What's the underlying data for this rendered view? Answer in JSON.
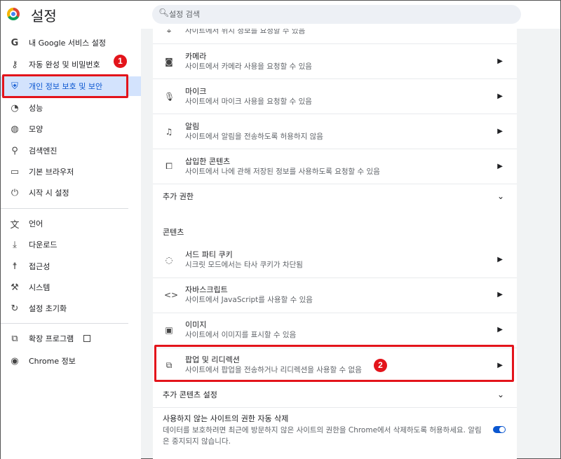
{
  "header": {
    "title": "설정",
    "search_placeholder": "설정 검색"
  },
  "sidebar": {
    "items": [
      {
        "label": "내 Google 서비스 설정",
        "icon": "google-g-icon"
      },
      {
        "label": "자동 완성 및 비밀번호",
        "icon": "key-icon"
      },
      {
        "label": "개인 정보 보호 및 보안",
        "icon": "shield-icon"
      },
      {
        "label": "성능",
        "icon": "speedometer-icon"
      },
      {
        "label": "모양",
        "icon": "palette-icon"
      },
      {
        "label": "검색엔진",
        "icon": "search-icon"
      },
      {
        "label": "기본 브라우저",
        "icon": "browser-icon"
      },
      {
        "label": "시작 시 설정",
        "icon": "power-icon"
      },
      {
        "label": "언어",
        "icon": "translate-icon"
      },
      {
        "label": "다운로드",
        "icon": "download-icon"
      },
      {
        "label": "접근성",
        "icon": "accessibility-icon"
      },
      {
        "label": "시스템",
        "icon": "wrench-icon"
      },
      {
        "label": "설정 초기화",
        "icon": "reset-icon"
      },
      {
        "label": "확장 프로그램",
        "icon": "puzzle-icon"
      },
      {
        "label": "Chrome 정보",
        "icon": "chrome-icon"
      }
    ]
  },
  "annotations": {
    "badge1": "1",
    "badge2": "2"
  },
  "content": {
    "top_partial": "사이트에서 위치 정보를 요청할 수 있음",
    "permissions": [
      {
        "title": "카메라",
        "sub": "사이트에서 카메라 사용을 요청할 수 있음",
        "icon": "camera-icon"
      },
      {
        "title": "마이크",
        "sub": "사이트에서 마이크 사용을 요청할 수 있음",
        "icon": "mic-icon"
      },
      {
        "title": "알림",
        "sub": "사이트에서 알림을 전송하도록 허용하지 않음",
        "icon": "bell-icon"
      },
      {
        "title": "삽입한 콘텐츠",
        "sub": "사이트에서 나에 관해 저장된 정보를 사용하도록 요청할 수 있음",
        "icon": "embedded-content-icon"
      }
    ],
    "extra_permissions": "추가 권한",
    "contents_heading": "콘텐츠",
    "content_items": [
      {
        "title": "서드 파티 쿠키",
        "sub": "시크릿 모드에서는 타사 쿠키가 차단됨",
        "icon": "cookie-icon"
      },
      {
        "title": "자바스크립트",
        "sub": "사이트에서 JavaScript를 사용할 수 있음",
        "icon": "code-icon"
      },
      {
        "title": "이미지",
        "sub": "사이트에서 이미지를 표시할 수 있음",
        "icon": "image-icon"
      },
      {
        "title": "팝업 및 리디렉션",
        "sub": "사이트에서 팝업을 전송하거나 리디렉션을 사용할 수 없음",
        "icon": "popup-icon"
      }
    ],
    "extra_content": "추가 콘텐츠 설정",
    "auto_delete": {
      "title": "사용하지 않는 사이트의 권한 자동 삭제",
      "desc_line1": "데이터를 보호하려면 최근에 방문하지 않은 사이트의 권한을 Chrome에서 삭제하도록 허용하세요. 알림",
      "desc_line2": "은 중지되지 않습니다.",
      "enabled": true
    }
  }
}
